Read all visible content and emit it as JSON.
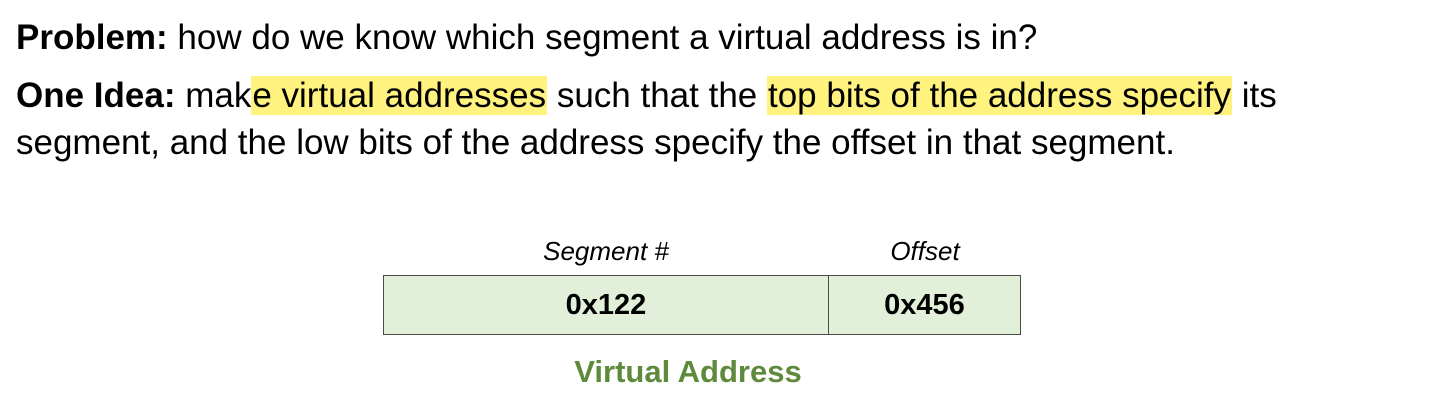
{
  "problem": {
    "label": "Problem:",
    "text": " how do we know which segment a virtual address is in?"
  },
  "idea": {
    "label": "One Idea:",
    "t1": " mak",
    "h1": "e virtual addresses",
    "t2": " such that the ",
    "h2": "top bits of the address specify",
    "t3": " its",
    "line2": "segment, and the low bits of the address specify the offset in that segment."
  },
  "diagram": {
    "segment_header": "Segment #",
    "offset_header": "Offset",
    "segment_value": "0x122",
    "offset_value": "0x456",
    "caption": "Virtual Address"
  },
  "colors": {
    "highlight": "#fff27f",
    "box_fill": "#e2efd9",
    "caption": "#5d8a3b"
  }
}
